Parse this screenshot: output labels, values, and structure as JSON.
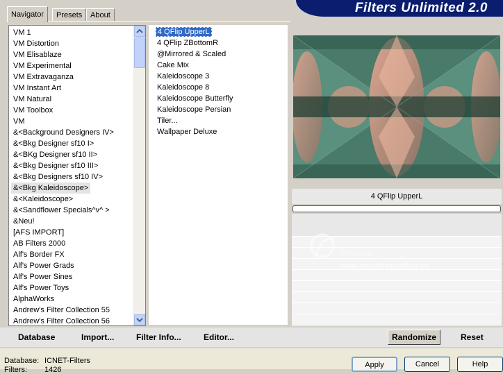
{
  "tabs": [
    {
      "label": "Navigator",
      "active": true
    },
    {
      "label": "Presets",
      "active": false
    },
    {
      "label": "About",
      "active": false
    }
  ],
  "header": {
    "title": "Filters Unlimited 2.0"
  },
  "categories": [
    "VM 1",
    "VM Distortion",
    "VM Elisablaze",
    "VM Experimental",
    "VM Extravaganza",
    "VM Instant Art",
    "VM Natural",
    "VM Toolbox",
    "VM",
    "&<Background Designers IV>",
    "&<Bkg Designer sf10 I>",
    "&<BKg Designer sf10 II>",
    "&<Bkg Designer sf10 III>",
    "&<Bkg Designers sf10 IV>",
    "&<Bkg Kaleidoscope>",
    "&<Kaleidoscope>",
    "&<Sandflower Specials^v^ >",
    "&Neu!",
    "[AFS IMPORT]",
    "AB Filters 2000",
    "Alf's Border FX",
    "Alf's Power Grads",
    "Alf's Power Sines",
    "Alf's Power Toys",
    "AlphaWorks",
    "Andrew's Filter Collection 55",
    "Andrew's Filter Collection 56"
  ],
  "selected_category": "&<Bkg Kaleidoscope>",
  "filters": [
    "4 QFlip UpperL",
    "4 QFlip ZBottomR",
    "@Mirrored & Scaled",
    "Cake Mix",
    "Kaleidoscope 3",
    "Kaleidoscope 8",
    "Kaleidoscope Butterfly",
    "Kaleidoscope Persian",
    "Tiler...",
    "Wallpaper Deluxe"
  ],
  "selected_filter": "4 QFlip UpperL",
  "preview": {
    "filter_name": "4 QFlip UpperL",
    "progress": 0
  },
  "watermark": {
    "line1": "Pinuccia",
    "line2": "www.maidiregrafica.eu"
  },
  "toolbar": {
    "database": "Database",
    "import": "Import...",
    "filter_info": "Filter Info...",
    "editor": "Editor...",
    "randomize": "Randomize",
    "reset": "Reset"
  },
  "footer": {
    "database_label": "Database:",
    "database_value": "ICNET-Filters",
    "filters_label": "Filters:",
    "filters_value": "1426",
    "apply": "Apply",
    "cancel": "Cancel",
    "help": "Help"
  },
  "colors": {
    "selection": "#316ac5",
    "banner": "#0a1d6e",
    "preview_teal": "#3f6e60",
    "preview_peach": "#d99a84"
  }
}
